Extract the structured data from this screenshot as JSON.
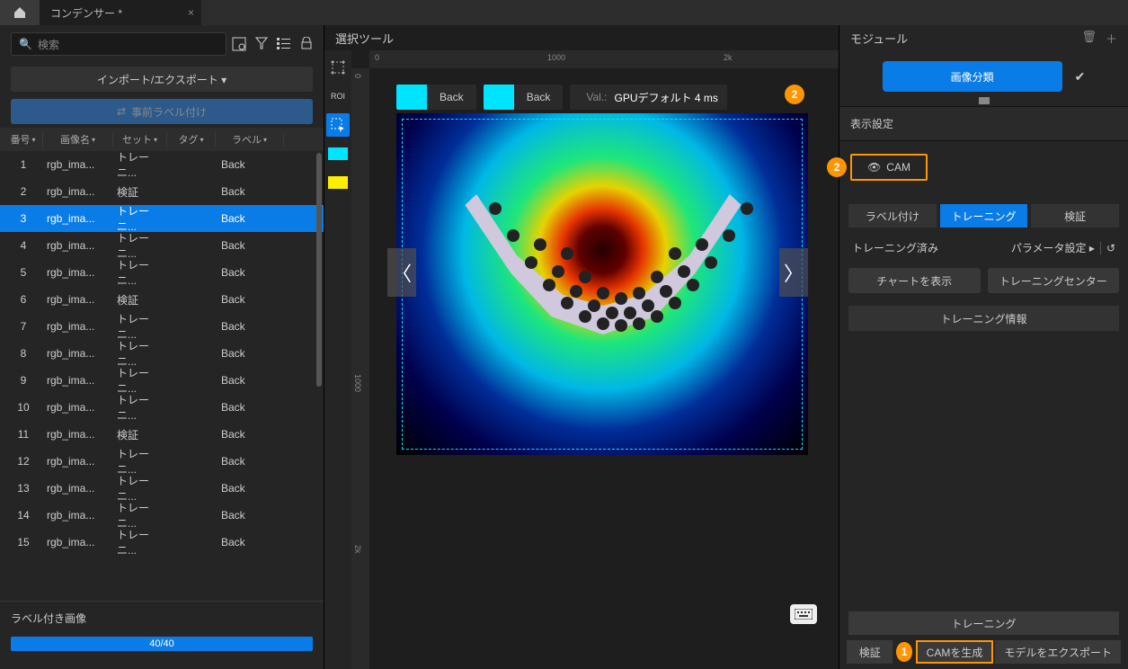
{
  "titlebar": {
    "tab_title": "コンデンサー *"
  },
  "left": {
    "search_placeholder": "検索",
    "import_export": "インポート/エクスポート ▾",
    "prelabel": "事前ラベル付け",
    "columns": {
      "num": "番号",
      "name": "画像名",
      "set": "セット",
      "tag": "タグ",
      "label": "ラベル"
    },
    "rows": [
      {
        "n": "1",
        "name": "rgb_ima...",
        "set": "トレーニ...",
        "tag": "",
        "label": "Back"
      },
      {
        "n": "2",
        "name": "rgb_ima...",
        "set": "検証",
        "tag": "",
        "label": "Back"
      },
      {
        "n": "3",
        "name": "rgb_ima...",
        "set": "トレーニ...",
        "tag": "",
        "label": "Back",
        "selected": true
      },
      {
        "n": "4",
        "name": "rgb_ima...",
        "set": "トレーニ...",
        "tag": "",
        "label": "Back"
      },
      {
        "n": "5",
        "name": "rgb_ima...",
        "set": "トレーニ...",
        "tag": "",
        "label": "Back"
      },
      {
        "n": "6",
        "name": "rgb_ima...",
        "set": "検証",
        "tag": "",
        "label": "Back"
      },
      {
        "n": "7",
        "name": "rgb_ima...",
        "set": "トレーニ...",
        "tag": "",
        "label": "Back"
      },
      {
        "n": "8",
        "name": "rgb_ima...",
        "set": "トレーニ...",
        "tag": "",
        "label": "Back"
      },
      {
        "n": "9",
        "name": "rgb_ima...",
        "set": "トレーニ...",
        "tag": "",
        "label": "Back"
      },
      {
        "n": "10",
        "name": "rgb_ima...",
        "set": "トレーニ...",
        "tag": "",
        "label": "Back"
      },
      {
        "n": "11",
        "name": "rgb_ima...",
        "set": "検証",
        "tag": "",
        "label": "Back"
      },
      {
        "n": "12",
        "name": "rgb_ima...",
        "set": "トレーニ...",
        "tag": "",
        "label": "Back"
      },
      {
        "n": "13",
        "name": "rgb_ima...",
        "set": "トレーニ...",
        "tag": "",
        "label": "Back"
      },
      {
        "n": "14",
        "name": "rgb_ima...",
        "set": "トレーニ...",
        "tag": "",
        "label": "Back"
      },
      {
        "n": "15",
        "name": "rgb_ima...",
        "set": "トレーニ...",
        "tag": "",
        "label": "Back"
      }
    ],
    "labeled_images": "ラベル付き画像",
    "progress_text": "40/40",
    "progress_pct": 100
  },
  "center": {
    "title": "選択ツール",
    "roi_label": "ROI",
    "ruler_0": "0",
    "ruler_1000": "1000",
    "ruler_2k": "2k",
    "ruler_v0": "0",
    "ruler_v1000": "1000",
    "ruler_v2k": "2k",
    "badge1_text": "Back",
    "badge2_text": "Back",
    "val_label": "Val.:",
    "val_value": "GPUデフォルト 4 ms",
    "callout2": "2",
    "swatch1": "#00e5ff",
    "swatch2": "#ffee00"
  },
  "right": {
    "module": "モジュール",
    "classify": "画像分類",
    "display_settings": "表示設定",
    "cam": "CAM",
    "tabs": {
      "label": "ラベル付け",
      "train": "トレーニング",
      "val": "検証"
    },
    "trained": "トレーニング済み",
    "param_settings": "パラメータ設定",
    "show_chart": "チャートを表示",
    "training_center": "トレーニングセンター",
    "training_info": "トレーニング情報",
    "bottom_train": "トレーニング",
    "bottom_val": "検証",
    "callout1": "1",
    "gen_cam": "CAMを生成",
    "export_model": "モデルをエクスポート"
  }
}
